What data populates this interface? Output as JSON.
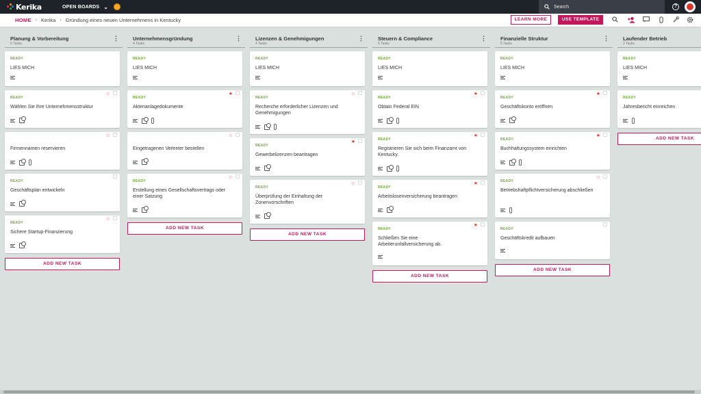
{
  "app": {
    "name": "Kerika",
    "open_boards": "OPEN BOARDS"
  },
  "search": {
    "label": "Search"
  },
  "breadcrumb": {
    "home": "HOME",
    "org": "Kerika",
    "board": "Gründung eines neuen Unternehmens in Kentucky"
  },
  "toolbar": {
    "learn_more": "LEARN MORE",
    "use_template": "USE TEMPLATE"
  },
  "colors": {
    "accent": "#c2185b",
    "ready": "#6fa83a",
    "star": "#e53935"
  },
  "add_task_label": "ADD NEW TASK",
  "columns": [
    {
      "title": "Planung & Vorbereitung",
      "count": "5 Tasks",
      "cards": [
        {
          "status": "READY",
          "title": "LIES MICH",
          "star": false,
          "chat": true,
          "task": false,
          "attach": false
        },
        {
          "status": "READY",
          "title": "Wählen Sie Ihre Unternehmensstruktur",
          "star": "outline",
          "chat": true,
          "task": true,
          "attach": false
        },
        {
          "status": "",
          "title": "Firmennamen reservieren",
          "star": "outline",
          "chat": true,
          "task": true,
          "attach": true
        },
        {
          "status": "READY",
          "title": "Geschäftsplan entwickeln",
          "star": false,
          "chat": true,
          "task": true,
          "attach": false
        },
        {
          "status": "READY",
          "title": "Sichere Startup-Finanzierung",
          "star": "outline",
          "chat": true,
          "task": true,
          "attach": false
        }
      ]
    },
    {
      "title": "Unternehmensgründung",
      "count": "4 Tasks",
      "cards": [
        {
          "status": "READY",
          "title": "LIES MICH",
          "star": false,
          "chat": true,
          "task": false,
          "attach": false
        },
        {
          "status": "READY",
          "title": "Aktenanlagedokumente",
          "star": "filled",
          "chat": true,
          "task": true,
          "attach": true
        },
        {
          "status": "",
          "title": "Eingetragenen Vertreter bestellen",
          "star": "outline",
          "chat": true,
          "task": true,
          "attach": false
        },
        {
          "status": "READY",
          "title": "Erstellung eines Gesellschaftsvertrags oder einer Satzung",
          "star": "outline",
          "chat": true,
          "task": true,
          "attach": false
        }
      ]
    },
    {
      "title": "Lizenzen & Genehmigungen",
      "count": "4 Tasks",
      "cards": [
        {
          "status": "READY",
          "title": "LIES MICH",
          "star": false,
          "chat": true,
          "task": false,
          "attach": false
        },
        {
          "status": "READY",
          "title": "Recherche erforderlicher Lizenzen und Genehmigungen",
          "star": "outline",
          "chat": true,
          "task": true,
          "attach": true
        },
        {
          "status": "READY",
          "title": "Gewerbelizenzen beantragen",
          "star": "filled",
          "chat": true,
          "task": true,
          "attach": false
        },
        {
          "status": "READY",
          "title": "Überprüfung der Einhaltung der Zonenvorschriften",
          "star": "outline",
          "chat": true,
          "task": true,
          "attach": false
        }
      ]
    },
    {
      "title": "Steuern & Compliance",
      "count": "5 Tasks",
      "cards": [
        {
          "status": "READY",
          "title": "LIES MICH",
          "star": false,
          "chat": true,
          "task": false,
          "attach": false
        },
        {
          "status": "READY",
          "title": "Obtain Federal EIN",
          "star": "filled",
          "chat": true,
          "task": true,
          "attach": true
        },
        {
          "status": "READY",
          "title": "Registrieren Sie sich beim Finanzamt von Kentucky.",
          "star": "filled",
          "chat": true,
          "task": true,
          "attach": true
        },
        {
          "status": "READY",
          "title": "Arbeitslosenversicherung beantragen",
          "star": "filled",
          "chat": true,
          "task": true,
          "attach": false
        },
        {
          "status": "READY",
          "title": "Schließen Sie eine Arbeiterunfallversicherung ab.",
          "star": "filled",
          "chat": true,
          "task": false,
          "attach": false
        }
      ]
    },
    {
      "title": "Finanzielle Struktur",
      "count": "5 Tasks",
      "cards": [
        {
          "status": "READY",
          "title": "LIES MICH",
          "star": false,
          "chat": true,
          "task": false,
          "attach": false
        },
        {
          "status": "READY",
          "title": "Geschäftskonto eröffnen",
          "star": "filled",
          "chat": true,
          "task": true,
          "attach": false
        },
        {
          "status": "READY",
          "title": "Buchhaltungssystem einrichten",
          "star": "filled",
          "chat": true,
          "task": true,
          "attach": true
        },
        {
          "status": "READY",
          "title": "Betriebshaftpflichtversicherung abschließen",
          "star": "outline",
          "chat": true,
          "task": false,
          "attach": true
        },
        {
          "status": "READY",
          "title": "Geschäftskredit aufbauen",
          "star": false,
          "chat": true,
          "task": false,
          "attach": false
        }
      ]
    },
    {
      "title": "Laufender Betrieb",
      "count": "2 Tasks",
      "cards": [
        {
          "status": "READY",
          "title": "LIES MICH",
          "star": false,
          "chat": true,
          "task": false,
          "attach": false
        },
        {
          "status": "READY",
          "title": "Jahresbericht einreichen",
          "star": false,
          "chat": true,
          "task": false,
          "attach": true
        }
      ]
    }
  ]
}
